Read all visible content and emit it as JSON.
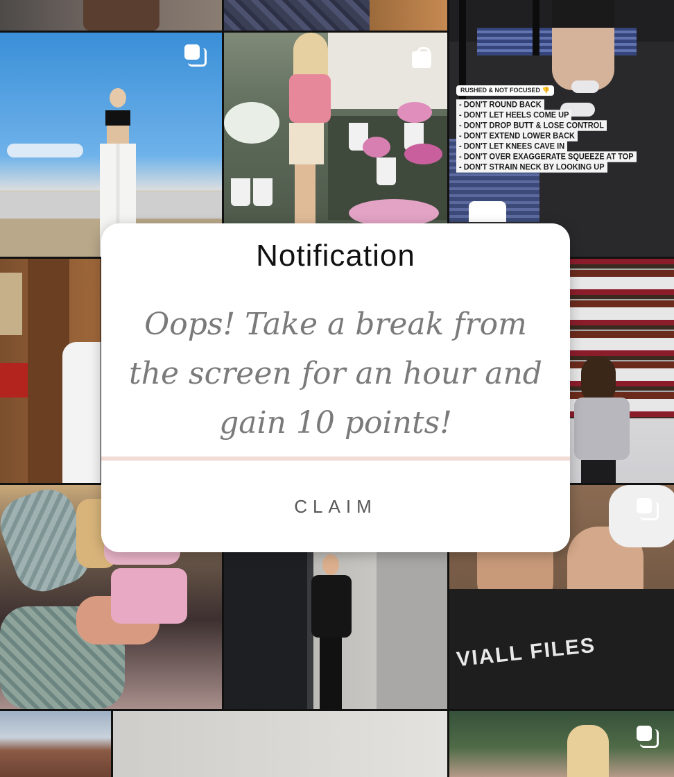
{
  "notification": {
    "title": "Notification",
    "message": "Oops! Take a break from the screen for an hour and gain 10 points!",
    "claim_label": "CLAIM",
    "divider_color": "#f2ddd6"
  },
  "grid_posts": [
    {
      "position": 1,
      "icon": null
    },
    {
      "position": 2,
      "icon": null
    },
    {
      "position": 3,
      "icon": "reel-icon"
    },
    {
      "position": 4,
      "icon": "multi-photo-icon"
    },
    {
      "position": 5,
      "icon": "shopping-bag-icon"
    },
    {
      "position": 6,
      "icon": null
    },
    {
      "position": 7,
      "icon": null
    },
    {
      "position": 8,
      "icon": null
    },
    {
      "position": 9,
      "icon": "multi-photo-icon"
    },
    {
      "position": 10,
      "icon": null
    },
    {
      "position": 11,
      "icon": null
    },
    {
      "position": 12,
      "icon": "multi-photo-icon"
    }
  ],
  "story_overlay": {
    "tag": "RUSHED & NOT FOCUSED 👎",
    "lines": [
      "- DON'T ROUND BACK",
      "- DON'T LET HEELS COME UP",
      "- DON'T DROP BUTT & LOSE CONTROL",
      "- DON'T EXTEND LOWER BACK",
      "- DON'T LET KNEES CAVE IN",
      "- DON'T OVER EXAGGERATE SQUEEZE AT TOP",
      "- DON'T STRAIN NECK BY LOOKING UP"
    ]
  },
  "hoodie_text": "VIALL FILES"
}
